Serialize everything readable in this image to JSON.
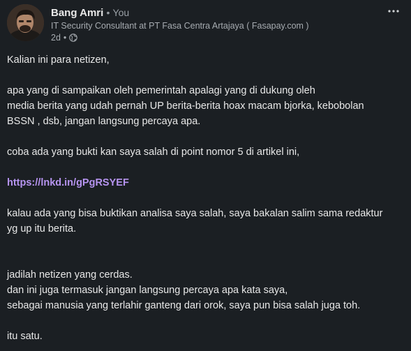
{
  "post": {
    "author": {
      "name": "Bang Amri",
      "separator": "•",
      "relation": "You",
      "headline": "IT Security Consultant at PT Fasa Centra Artajaya ( Fasapay.com )",
      "time": "2d",
      "time_separator": "•",
      "visibility_icon": "globe-icon"
    },
    "more_icon": "more-horizontal-icon",
    "body": {
      "p1": "Kalian ini para netizen,",
      "p2_l1": "apa yang di sampaikan oleh pemerintah apalagi yang di dukung oleh",
      "p2_l2": "media berita yang udah pernah UP berita-berita hoax macam bjorka, kebobolan",
      "p2_l3": "BSSN , dsb, jangan langsung percaya apa.",
      "p3": "coba ada yang bukti kan saya salah di point nomor 5 di artikel ini,",
      "link": "https://lnkd.in/gPgRSYEF",
      "p5_l1": "kalau ada yang bisa buktikan analisa saya salah, saya bakalan salim sama redaktur",
      "p5_l2": "yg up itu berita.",
      "p6_l1": "jadilah netizen yang cerdas.",
      "p6_l2": "dan ini juga termasuk jangan langsung percaya apa kata saya,",
      "p6_l3": "sebagai manusia yang terlahir ganteng dari orok, saya pun bisa salah juga toh.",
      "p7": "itu satu."
    }
  },
  "colors": {
    "background": "#1b1f23",
    "text": "#e8e8e8",
    "muted": "#a6abb0",
    "link": "#b694f0"
  }
}
